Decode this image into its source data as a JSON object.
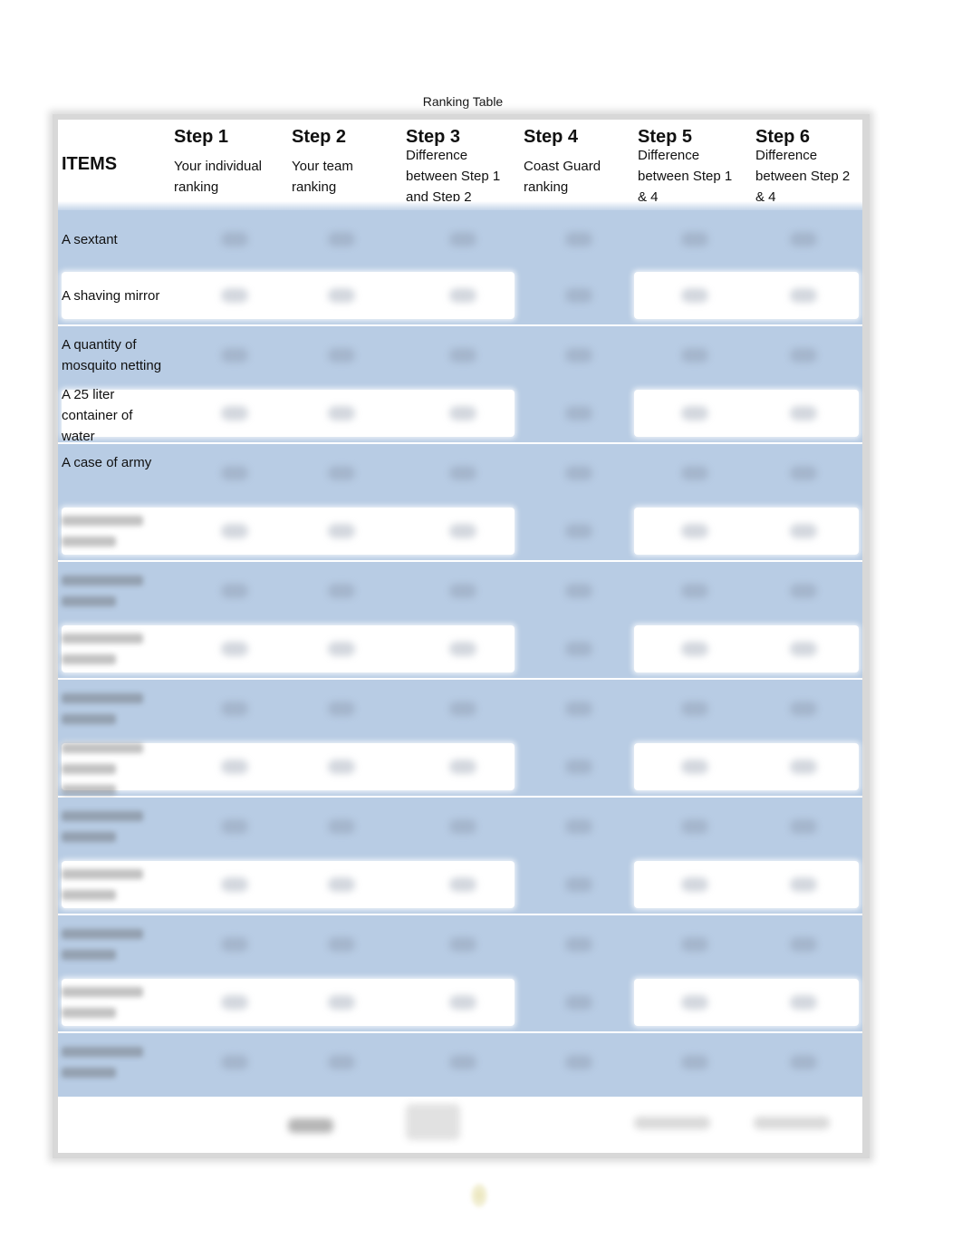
{
  "caption": "Ranking Table",
  "header": {
    "items_label": "ITEMS",
    "steps": [
      {
        "title": "Step 1",
        "desc_lines": [
          "Your individual",
          "ranking"
        ]
      },
      {
        "title": "Step 2",
        "desc_lines": [
          "Your team",
          "ranking"
        ]
      },
      {
        "title": "Step 3",
        "desc_lines": [
          "Difference",
          "between Step 1",
          "and Step 2"
        ]
      },
      {
        "title": "Step 4",
        "desc_lines": [
          "Coast Guard",
          "ranking"
        ]
      },
      {
        "title": "Step 5",
        "desc_lines": [
          "Difference",
          "between Step 1",
          "& 4"
        ]
      },
      {
        "title": "Step 6",
        "desc_lines": [
          "Difference",
          "between Step 2",
          "& 4"
        ]
      }
    ]
  },
  "rows": [
    {
      "lines": [
        "A sextant"
      ],
      "blurred": false
    },
    {
      "lines": [
        "A shaving mirror"
      ],
      "blurred": false
    },
    {
      "lines": [
        "A quantity of",
        "mosquito netting"
      ],
      "blurred": false
    },
    {
      "lines": [
        "A 25 liter",
        "container of",
        "water"
      ],
      "blurred": false
    },
    {
      "lines": [
        "A case of army",
        ""
      ],
      "blurred": false
    },
    {
      "lines": [
        "",
        ""
      ],
      "blurred": true
    },
    {
      "lines": [
        "",
        ""
      ],
      "blurred": true
    },
    {
      "lines": [
        "",
        ""
      ],
      "blurred": true
    },
    {
      "lines": [
        "",
        ""
      ],
      "blurred": true
    },
    {
      "lines": [
        "",
        "",
        ""
      ],
      "blurred": true
    },
    {
      "lines": [
        "",
        ""
      ],
      "blurred": true
    },
    {
      "lines": [
        "",
        ""
      ],
      "blurred": true
    },
    {
      "lines": [
        "",
        ""
      ],
      "blurred": true
    },
    {
      "lines": [
        "",
        ""
      ],
      "blurred": true
    },
    {
      "lines": [
        "",
        ""
      ],
      "blurred": true
    }
  ],
  "footer": {
    "totals_label": ""
  }
}
